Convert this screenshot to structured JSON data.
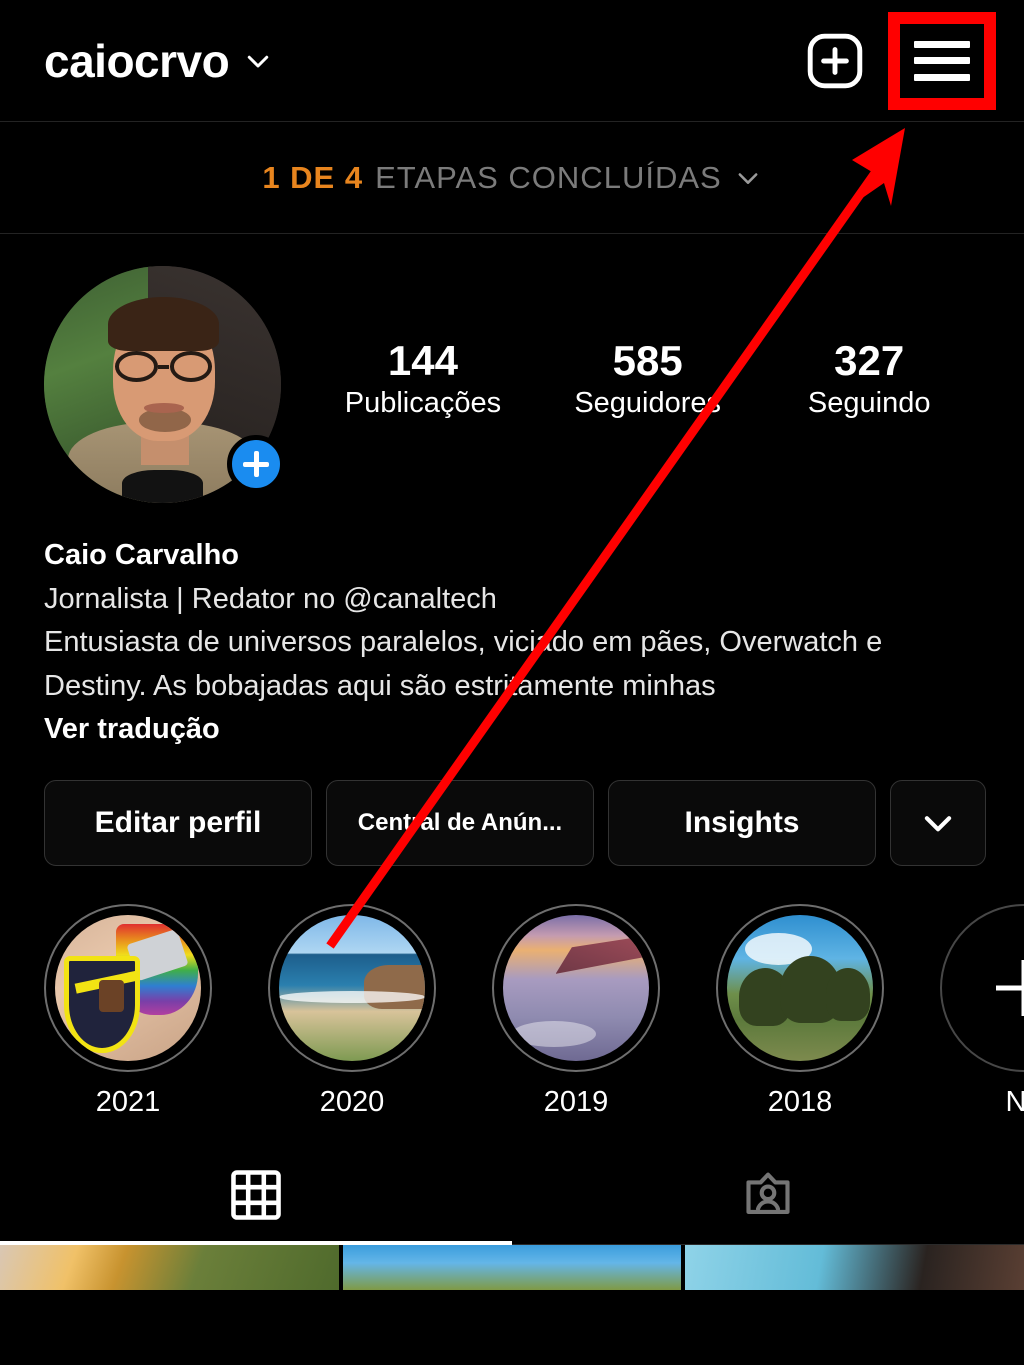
{
  "header": {
    "username": "caiocrvo",
    "username_chevron_icon": "chevron-down-icon",
    "add_post_icon": "plus-square-icon",
    "menu_icon": "hamburger-menu-icon"
  },
  "progress": {
    "count_text": "1 DE 4",
    "label_text": "ETAPAS CONCLUÍDAS",
    "chevron_icon": "chevron-down-icon",
    "accent_color": "#E8851E",
    "label_color": "#7B7B7B"
  },
  "profile": {
    "avatar_name": "Caio Carvalho",
    "add_story_badge_icon": "plus-circle-icon",
    "add_story_badge_color": "#1A8CF0",
    "stats": [
      {
        "value": "144",
        "label": "Publicações"
      },
      {
        "value": "585",
        "label": "Seguidores"
      },
      {
        "value": "327",
        "label": "Seguindo"
      }
    ],
    "bio": {
      "display_name": "Caio Carvalho",
      "line1": "Jornalista | Redator no @canaltech",
      "line2": "Entusiasta de universos paralelos, viciado em pães, Overwatch e",
      "line3": "Destiny. As bobajadas aqui são estritamente minhas",
      "translate_label": "Ver tradução"
    }
  },
  "actions": {
    "edit_profile": "Editar perfil",
    "ads_center": "Central de Anún...",
    "insights": "Insights",
    "more_icon": "chevron-down-icon"
  },
  "highlights": [
    {
      "label": "2021",
      "art": "pins"
    },
    {
      "label": "2020",
      "art": "beach"
    },
    {
      "label": "2019",
      "art": "plane"
    },
    {
      "label": "2018",
      "art": "trees"
    },
    {
      "label": "No",
      "art": "new",
      "icon": "plus-icon"
    }
  ],
  "tabs": [
    {
      "name": "grid-tab",
      "icon": "grid-icon",
      "active": true
    },
    {
      "name": "tagged-tab",
      "icon": "tagged-person-icon",
      "active": false
    }
  ],
  "grid_cells": [
    {
      "name": "post-thumbnail-1"
    },
    {
      "name": "post-thumbnail-2"
    },
    {
      "name": "post-thumbnail-3"
    }
  ],
  "annotation": {
    "highlight_box_color": "#FF0000",
    "arrow_color": "#FF0000",
    "target": "hamburger-menu-icon"
  }
}
